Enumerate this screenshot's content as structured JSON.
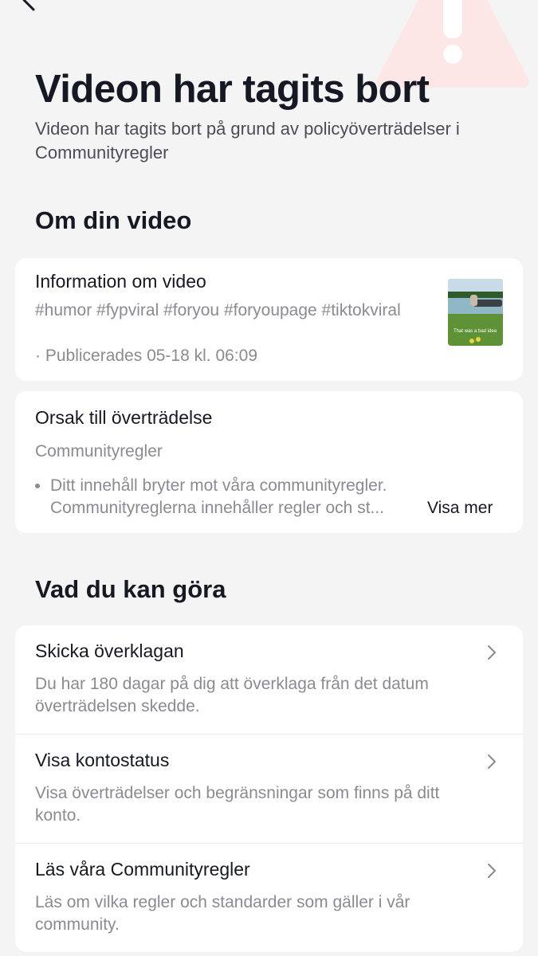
{
  "header": {
    "title": "Videon har tagits bort",
    "subtitle": "Videon har tagits bort på grund av policyöverträdelser i Communityregler"
  },
  "about_section": {
    "title": "Om din video",
    "video_card": {
      "title": "Information om video",
      "tags": "#humor #fypviral #foryou #foryoupage #tiktokviral",
      "published": "· Publicerades 05-18 kl. 06:09",
      "thumbnail_caption": "That was a bad idea"
    },
    "violation_card": {
      "title": "Orsak till överträdelse",
      "category": "Communityregler",
      "text_line1": "Ditt innehåll bryter mot våra communityregler.",
      "text_line2": "Communityreglerna innehåller regler och st...",
      "show_more": "Visa mer"
    }
  },
  "actions_section": {
    "title": "Vad du kan göra",
    "items": [
      {
        "title": "Skicka överklagan",
        "description": "Du har 180 dagar på dig att överklaga från det datum överträdelsen skedde."
      },
      {
        "title": "Visa kontostatus",
        "description": "Visa överträdelser och begränsningar som finns på ditt konto."
      },
      {
        "title": "Läs våra Communityregler",
        "description": "Läs om vilka regler och standarder som gäller i vår community."
      }
    ]
  },
  "icons": {
    "back": "back-arrow-icon",
    "warning": "warning-triangle-icon",
    "chevron": "chevron-right-icon"
  },
  "colors": {
    "background": "#f4f4f5",
    "card": "#ffffff",
    "text_primary": "#161823",
    "text_secondary": "#8a8b91",
    "warning_tint": "#fde3e3"
  }
}
